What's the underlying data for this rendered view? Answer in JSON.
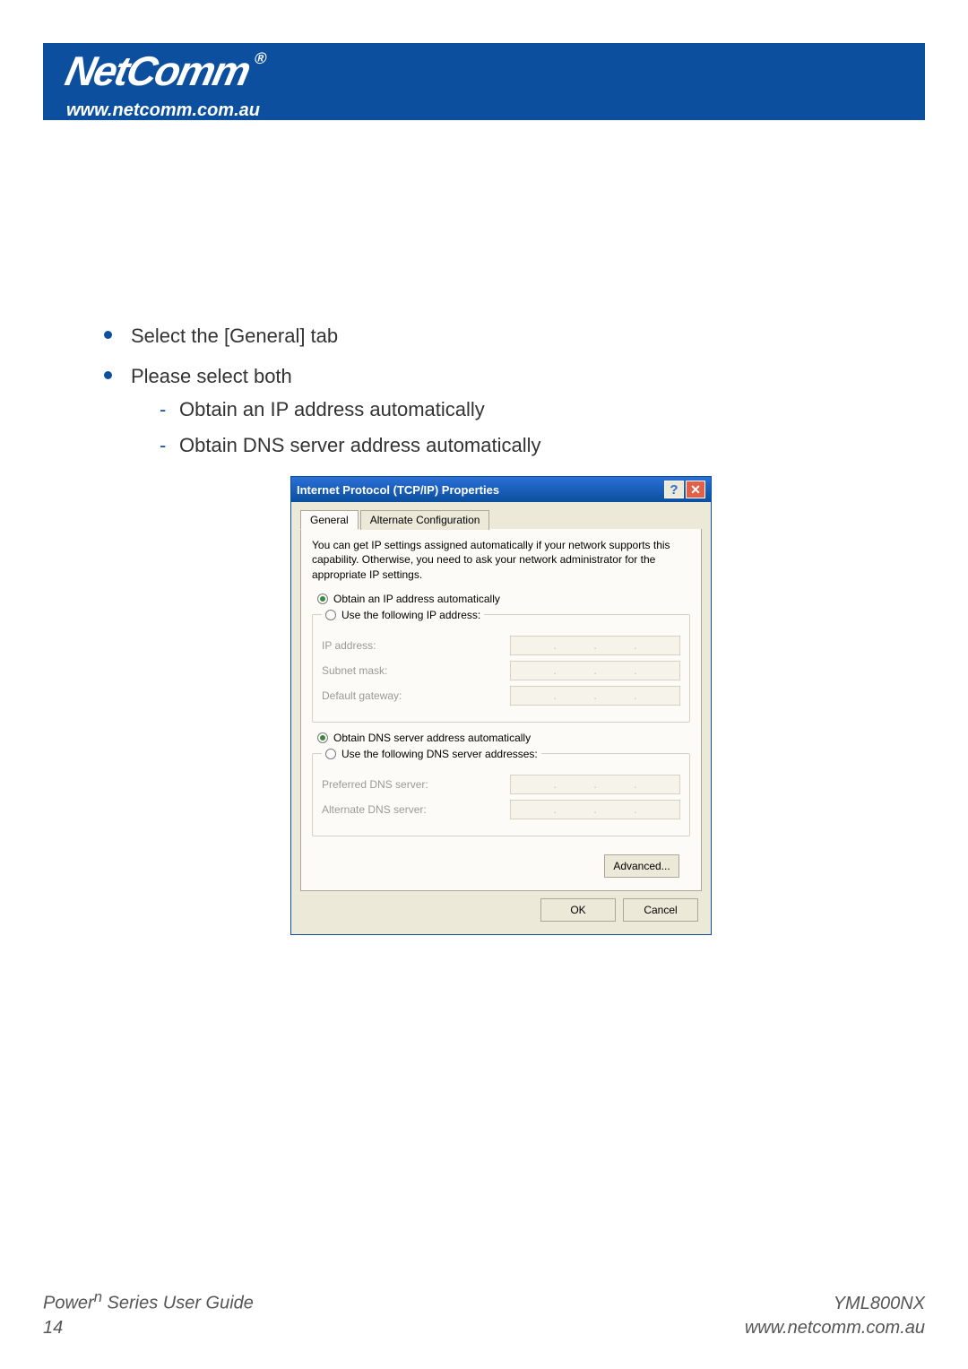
{
  "brand": {
    "name": "NetComm",
    "registered": "®",
    "url": "www.netcomm.com.au"
  },
  "content": {
    "bullets": [
      "Select the [General] tab",
      "Please select both"
    ],
    "sub": [
      "Obtain an IP address automatically",
      "Obtain DNS server address automatically"
    ]
  },
  "dialog": {
    "title": "Internet Protocol (TCP/IP) Properties",
    "help": "?",
    "close": "✕",
    "tabs": {
      "general": "General",
      "alt": "Alternate Configuration"
    },
    "info": "You can get IP settings assigned automatically if your network supports this capability. Otherwise, you need to ask your network administrator for the appropriate IP settings.",
    "ip": {
      "auto": "Obtain an IP address automatically",
      "manual": "Use the following IP address:",
      "ip_label": "IP address:",
      "mask_label": "Subnet mask:",
      "gw_label": "Default gateway:"
    },
    "dns": {
      "auto": "Obtain DNS server address automatically",
      "manual": "Use the following DNS server addresses:",
      "pref_label": "Preferred DNS server:",
      "alt_label": "Alternate DNS server:"
    },
    "buttons": {
      "advanced": "Advanced...",
      "ok": "OK",
      "cancel": "Cancel"
    }
  },
  "footer": {
    "series_prefix": "Power",
    "series_sup": "n",
    "series_suffix": " Series User Guide",
    "page": "14",
    "model": "YML800NX",
    "url": "www.netcomm.com.au"
  }
}
